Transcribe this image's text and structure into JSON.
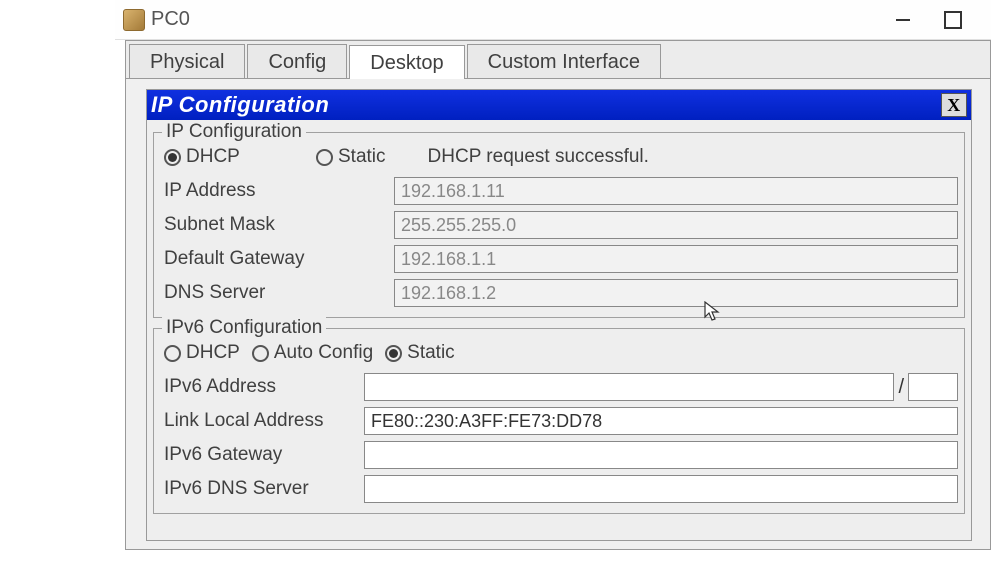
{
  "window": {
    "title": "PC0",
    "icon": "pc-icon"
  },
  "tabs": {
    "t0": "Physical",
    "t1": "Config",
    "t2": "Desktop",
    "t3": "Custom Interface",
    "active_index": 2
  },
  "panel": {
    "title": "IP Configuration",
    "close_label": "X"
  },
  "ipv4": {
    "legend": "IP Configuration",
    "radio_dhcp": "DHCP",
    "radio_static": "Static",
    "selected": "dhcp",
    "status_message": "DHCP request successful.",
    "fields": {
      "ip_label": "IP Address",
      "ip_value": "192.168.1.11",
      "mask_label": "Subnet Mask",
      "mask_value": "255.255.255.0",
      "gateway_label": "Default Gateway",
      "gateway_value": "192.168.1.1",
      "dns_label": "DNS Server",
      "dns_value": "192.168.1.2"
    }
  },
  "ipv6": {
    "legend": "IPv6 Configuration",
    "radio_dhcp": "DHCP",
    "radio_auto": "Auto Config",
    "radio_static": "Static",
    "selected": "static",
    "fields": {
      "addr_label": "IPv6 Address",
      "addr_value": "",
      "prefix_value": "",
      "linklocal_label": "Link Local Address",
      "linklocal_value": "FE80::230:A3FF:FE73:DD78",
      "gateway_label": "IPv6 Gateway",
      "gateway_value": "",
      "dns_label": "IPv6 DNS Server",
      "dns_value": ""
    }
  }
}
